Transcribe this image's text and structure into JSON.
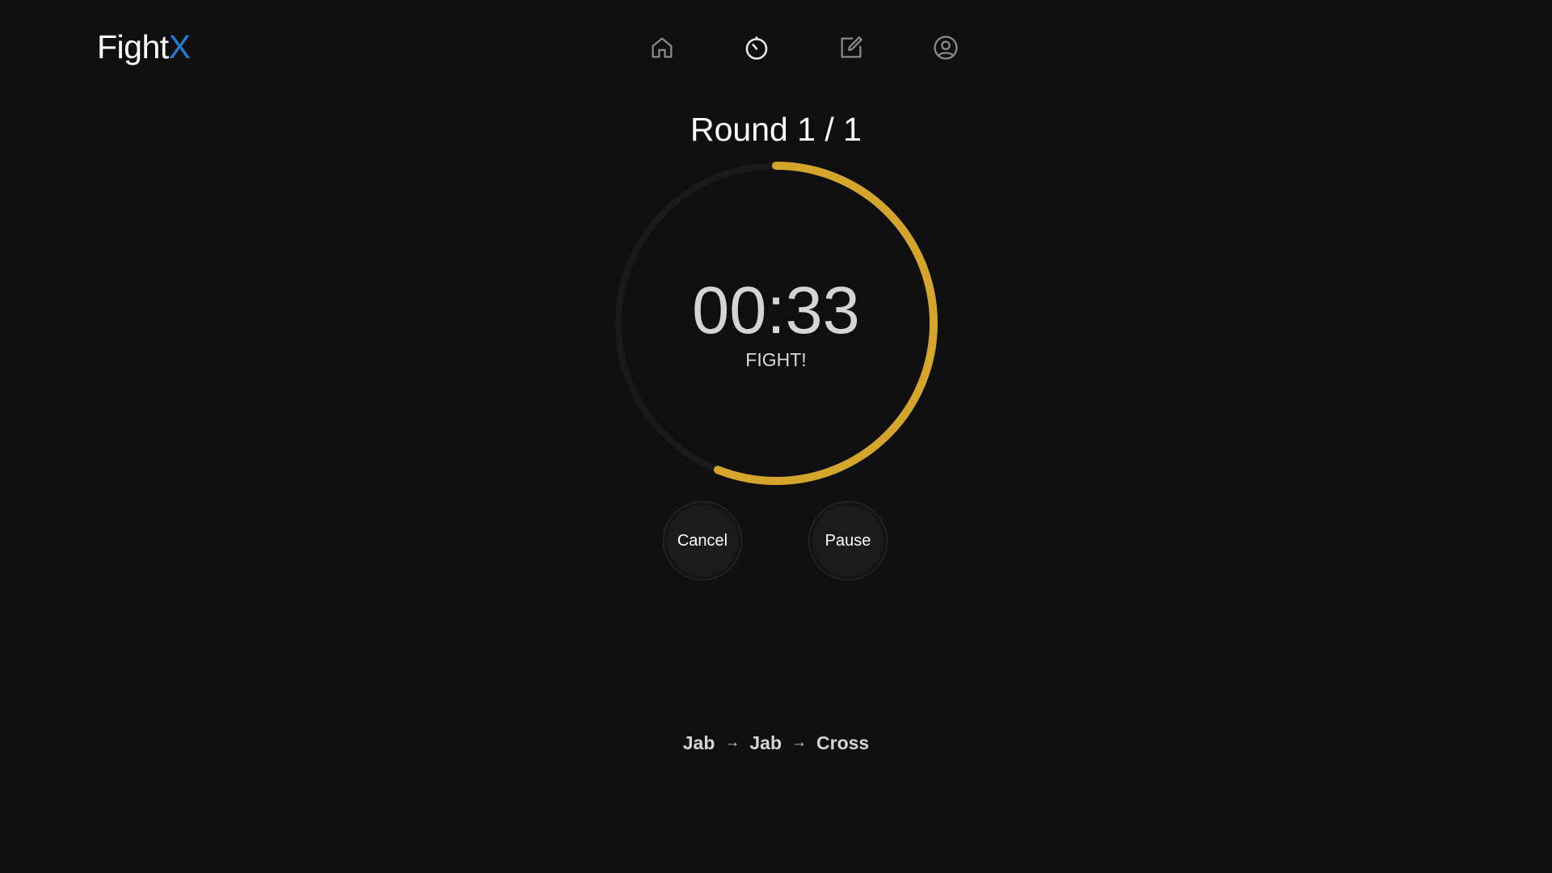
{
  "header": {
    "logo_main": "Fight",
    "logo_accent": "X",
    "nav": [
      {
        "name": "home",
        "icon": "home-icon",
        "active": false
      },
      {
        "name": "timer",
        "icon": "timer-icon",
        "active": true
      },
      {
        "name": "edit",
        "icon": "edit-icon",
        "active": false
      },
      {
        "name": "profile",
        "icon": "profile-icon",
        "active": false
      }
    ]
  },
  "round": {
    "title": "Round 1 / 1"
  },
  "timer": {
    "value": "00:33",
    "status": "FIGHT!",
    "progress": 0.56
  },
  "controls": {
    "cancel_label": "Cancel",
    "pause_label": "Pause"
  },
  "combo": {
    "moves": [
      "Jab",
      "Jab",
      "Cross"
    ],
    "separator": "→"
  },
  "colors": {
    "background": "#0f0f0f",
    "accent_blue": "#1e7fd6",
    "ring_progress": "#d4a52a",
    "ring_track": "#1a1a1a"
  }
}
